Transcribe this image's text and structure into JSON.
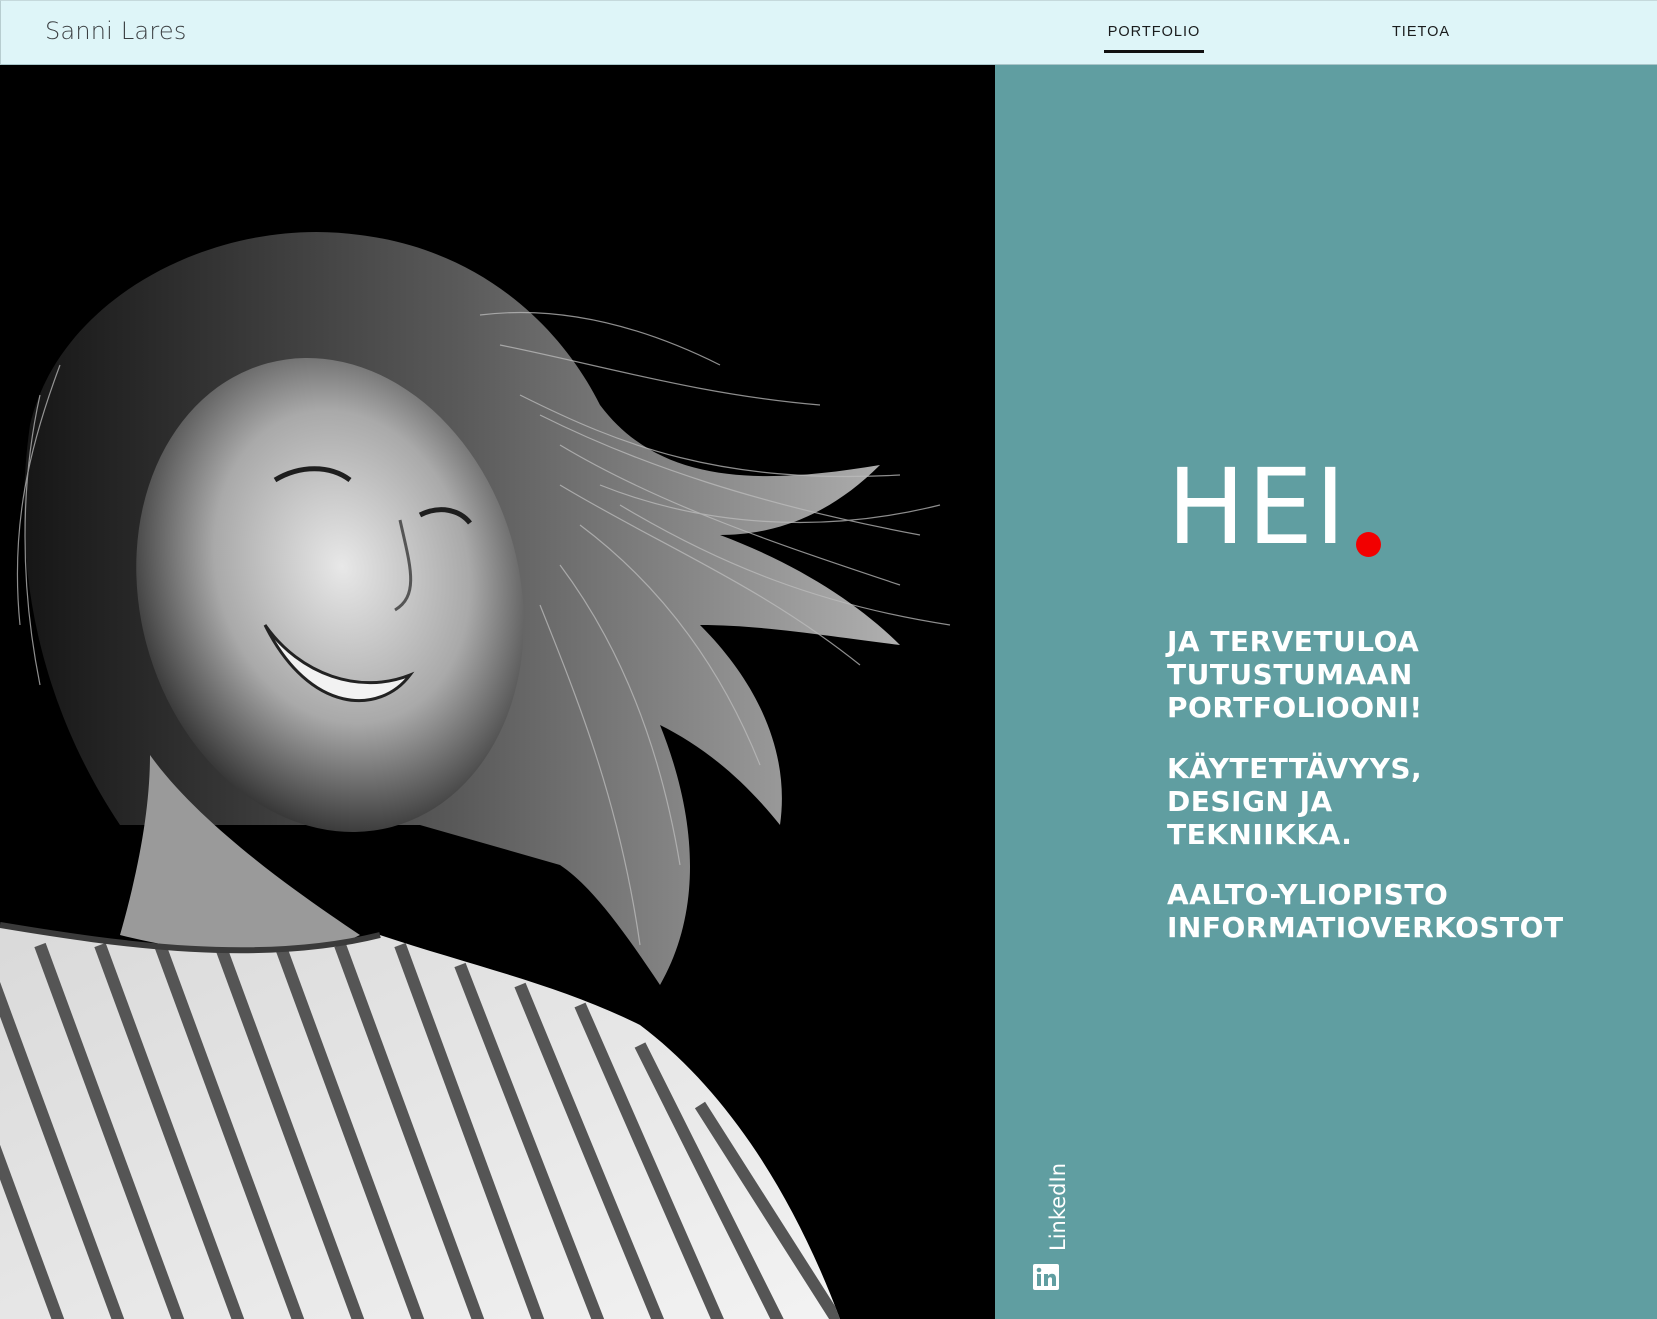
{
  "header": {
    "site_title": "Sanni Lares",
    "nav": [
      {
        "label": "PORTFOLIO",
        "active": true
      },
      {
        "label": "TIETOA",
        "active": false
      }
    ]
  },
  "hero": {
    "greeting": "HEI",
    "accent_dot_color": "#f20000",
    "blocks": [
      {
        "lines": [
          "JA TERVETULOA",
          "TUTUSTUMAAN",
          "PORTFOLIOONI!"
        ]
      },
      {
        "lines": [
          "KÄYTETTÄVYYS,",
          "DESIGN JA",
          "TEKNIIKKA."
        ]
      },
      {
        "lines": [
          "AALTO-YLIOPISTO",
          "INFORMATIOVERKOSTOT"
        ]
      }
    ]
  },
  "social": {
    "linkedin_label": "LinkedIn",
    "icon": "linkedin-icon"
  },
  "colors": {
    "header_bg": "#def5f8",
    "teal_panel": "#609ea1",
    "photo_bg": "#000000",
    "text_light": "#ffffff"
  }
}
